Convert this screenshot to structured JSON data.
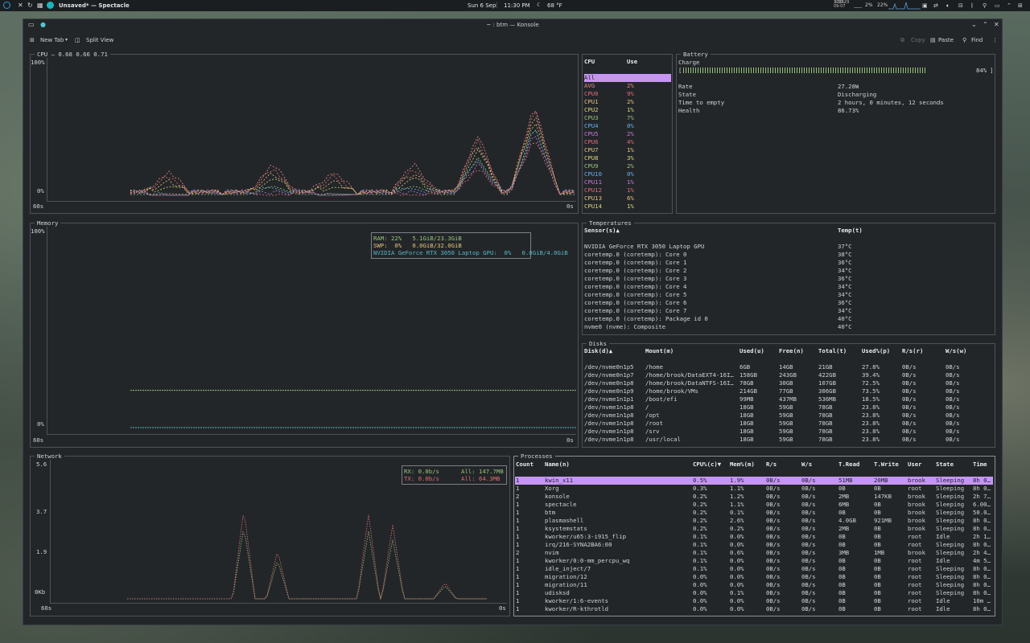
{
  "top_panel": {
    "app_title": "Unsaved* — Spectacle",
    "date": "Sun 6 Sep",
    "time": "11:30 PM",
    "weather": "68 °F",
    "small_clock_time": "3:30:29",
    "small_clock_date": "2026-09-07",
    "cpu_stat": "2%",
    "mem_stat": "22%"
  },
  "window": {
    "title": "~ : btm — Konsole",
    "toolbar": {
      "new_tab": "New Tab",
      "split_view": "Split View",
      "copy": "Copy",
      "paste": "Paste",
      "find": "Find"
    }
  },
  "cpu_graph": {
    "title": "CPU – 0.68 0.66 0.71",
    "y_top": "100%",
    "y_bottom": "0%",
    "x_left": "60s",
    "x_right": "0s"
  },
  "cpu_table": {
    "headers": [
      "CPU",
      "Use"
    ],
    "rows": [
      {
        "name": "All",
        "use": "",
        "color": "#1d1f22"
      },
      {
        "name": "AVG",
        "use": "2%",
        "color": "#e88a8a"
      },
      {
        "name": "CPU0",
        "use": "9%",
        "color": "#e06c75"
      },
      {
        "name": "CPU1",
        "use": "2%",
        "color": "#e5c07b"
      },
      {
        "name": "CPU2",
        "use": "1%",
        "color": "#d7d57a"
      },
      {
        "name": "CPU3",
        "use": "7%",
        "color": "#98c379"
      },
      {
        "name": "CPU4",
        "use": "0%",
        "color": "#61afef"
      },
      {
        "name": "CPU5",
        "use": "2%",
        "color": "#c678dd"
      },
      {
        "name": "CPU6",
        "use": "4%",
        "color": "#e06c75"
      },
      {
        "name": "CPU7",
        "use": "1%",
        "color": "#e5c07b"
      },
      {
        "name": "CPU8",
        "use": "3%",
        "color": "#d7d57a"
      },
      {
        "name": "CPU9",
        "use": "2%",
        "color": "#98c379"
      },
      {
        "name": "CPU10",
        "use": "0%",
        "color": "#61afef"
      },
      {
        "name": "CPU11",
        "use": "1%",
        "color": "#c678dd"
      },
      {
        "name": "CPU12",
        "use": "1%",
        "color": "#e06c75"
      },
      {
        "name": "CPU13",
        "use": "6%",
        "color": "#e5c07b"
      },
      {
        "name": "CPU14",
        "use": "1%",
        "color": "#d7d57a"
      }
    ]
  },
  "battery": {
    "title": "Battery",
    "charge_label": "Charge",
    "charge_pct_text": "84%",
    "charge_fraction": 0.84,
    "rows": [
      {
        "k": "Rate",
        "v": "27.28W"
      },
      {
        "k": "State",
        "v": "Discharging"
      },
      {
        "k": "Time to empty",
        "v": "2 hours, 0 minutes, 12 seconds"
      },
      {
        "k": "Health",
        "v": "86.73%"
      }
    ]
  },
  "memory": {
    "title": "Memory",
    "y_top": "100%",
    "y_bottom": "0%",
    "x_left": "60s",
    "x_right": "0s",
    "legend": [
      {
        "text": "RAM: 22%   5.1GiB/23.3GiB",
        "color": "#98c379"
      },
      {
        "text": "SWP:  0%   0.0GiB/32.0GiB",
        "color": "#e5c07b"
      },
      {
        "text": "NVIDIA GeForce RTX 3050 Laptop GPU:  0%   0.0GiB/4.0GiB",
        "color": "#56b6c2"
      }
    ],
    "ram_fraction": 0.22,
    "swap_fraction": 0.0
  },
  "temperatures": {
    "title": "Temperatures",
    "headers": [
      "Sensor(s)▲",
      "Temp(t)"
    ],
    "rows": [
      {
        "s": "NVIDIA GeForce RTX 3050 Laptop GPU",
        "t": "37°C"
      },
      {
        "s": "coretemp.0 (coretemp): Core 0",
        "t": "38°C"
      },
      {
        "s": "coretemp.0 (coretemp): Core 1",
        "t": "36°C"
      },
      {
        "s": "coretemp.0 (coretemp): Core 2",
        "t": "34°C"
      },
      {
        "s": "coretemp.0 (coretemp): Core 3",
        "t": "36°C"
      },
      {
        "s": "coretemp.0 (coretemp): Core 4",
        "t": "34°C"
      },
      {
        "s": "coretemp.0 (coretemp): Core 5",
        "t": "34°C"
      },
      {
        "s": "coretemp.0 (coretemp): Core 6",
        "t": "36°C"
      },
      {
        "s": "coretemp.0 (coretemp): Core 7",
        "t": "34°C"
      },
      {
        "s": "coretemp.0 (coretemp): Package id 0",
        "t": "40°C"
      },
      {
        "s": "nvme0 (nvme): Composite",
        "t": "40°C"
      }
    ]
  },
  "disks": {
    "title": "Disks",
    "headers": [
      "Disk(d)▲",
      "Mount(m)",
      "Used(u)",
      "Free(n)",
      "Total(t)",
      "Used%(p)",
      "R/s(r)",
      "W/s(w)"
    ],
    "rows": [
      [
        "/dev/nvme0n1p5",
        "/home",
        "6GB",
        "14GB",
        "21GB",
        "27.8%",
        "0B/s",
        "0B/s"
      ],
      [
        "/dev/nvme0n1p7",
        "/home/brook/DataEXT4-16I…",
        "158GB",
        "243GB",
        "422GB",
        "39.4%",
        "0B/s",
        "0B/s"
      ],
      [
        "/dev/nvme0n1p8",
        "/home/brook/DataNTFS-16I…",
        "78GB",
        "30GB",
        "107GB",
        "72.5%",
        "0B/s",
        "0B/s"
      ],
      [
        "/dev/nvme0n1p9",
        "/home/brook/VMs",
        "214GB",
        "77GB",
        "306GB",
        "73.5%",
        "0B/s",
        "0B/s"
      ],
      [
        "/dev/nvme1n1p1",
        "/boot/efi",
        "99MB",
        "437MB",
        "536MB",
        "18.5%",
        "0B/s",
        "0B/s"
      ],
      [
        "/dev/nvme1n1p8",
        "/",
        "18GB",
        "59GB",
        "78GB",
        "23.8%",
        "0B/s",
        "0B/s"
      ],
      [
        "/dev/nvme1n1p8",
        "/opt",
        "18GB",
        "59GB",
        "78GB",
        "23.8%",
        "0B/s",
        "0B/s"
      ],
      [
        "/dev/nvme1n1p8",
        "/root",
        "18GB",
        "59GB",
        "78GB",
        "23.8%",
        "0B/s",
        "0B/s"
      ],
      [
        "/dev/nvme1n1p8",
        "/srv",
        "18GB",
        "59GB",
        "78GB",
        "23.8%",
        "0B/s",
        "0B/s"
      ],
      [
        "/dev/nvme1n1p8",
        "/usr/local",
        "18GB",
        "59GB",
        "78GB",
        "23.8%",
        "0B/s",
        "0B/s"
      ]
    ]
  },
  "network": {
    "title": "Network",
    "y_ticks": [
      "5.6",
      "3.7",
      "1.9",
      "0Kb"
    ],
    "x_left": "60s",
    "x_right": "0s",
    "legend": [
      {
        "a": "RX: 0.0b/s",
        "b": "All: 147.7MB",
        "color": "#98c379"
      },
      {
        "a": "TX: 0.0b/s",
        "b": "All: 64.3MB",
        "color": "#e06c75"
      }
    ]
  },
  "processes": {
    "title": "Processes",
    "headers": [
      "Count",
      "Name(n)",
      "CPU%(c)▼",
      "Mem%(m)",
      "R/s",
      "W/s",
      "T.Read",
      "T.Write",
      "User",
      "State",
      "Time"
    ],
    "rows": [
      [
        "1",
        "kwin_x11",
        "0.5%",
        "1.9%",
        "0B/s",
        "0B/s",
        "51MB",
        "20MB",
        "brook",
        "Sleeping",
        "8h 0…"
      ],
      [
        "1",
        "Xorg",
        "0.3%",
        "1.1%",
        "0B/s",
        "0B/s",
        "0B",
        "0B",
        "root",
        "Sleeping",
        "8h 0…"
      ],
      [
        "2",
        "konsole",
        "0.2%",
        "1.2%",
        "0B/s",
        "0B/s",
        "2MB",
        "147KB",
        "brook",
        "Sleeping",
        "2h 7…"
      ],
      [
        "1",
        "spectacle",
        "0.2%",
        "1.1%",
        "0B/s",
        "0B/s",
        "6MB",
        "0B",
        "brook",
        "Sleeping",
        "6.00…"
      ],
      [
        "1",
        "btm",
        "0.2%",
        "0.1%",
        "0B/s",
        "0B/s",
        "0B",
        "0B",
        "brook",
        "Sleeping",
        "50.0…"
      ],
      [
        "1",
        "plasmashell",
        "0.2%",
        "2.6%",
        "0B/s",
        "0B/s",
        "4.0GB",
        "921MB",
        "brook",
        "Sleeping",
        "8h 0…"
      ],
      [
        "1",
        "ksystemstats",
        "0.2%",
        "0.2%",
        "0B/s",
        "0B/s",
        "2MB",
        "0B",
        "brook",
        "Sleeping",
        "8h 0…"
      ],
      [
        "1",
        "kworker/u65:3-i915_flip",
        "0.1%",
        "0.0%",
        "0B/s",
        "0B/s",
        "0B",
        "0B",
        "root",
        "Idle",
        "2h 1…"
      ],
      [
        "1",
        "irq/216-SYNA2BA6:00",
        "0.1%",
        "0.0%",
        "0B/s",
        "0B/s",
        "0B",
        "0B",
        "root",
        "Sleeping",
        "8h 0…"
      ],
      [
        "2",
        "nvim",
        "0.1%",
        "0.6%",
        "0B/s",
        "0B/s",
        "3MB",
        "1MB",
        "brook",
        "Sleeping",
        "2h 4…"
      ],
      [
        "1",
        "kworker/0:0-mm_percpu_wq",
        "0.1%",
        "0.0%",
        "0B/s",
        "0B/s",
        "0B",
        "0B",
        "root",
        "Idle",
        "4m 5…"
      ],
      [
        "1",
        "idle_inject/7",
        "0.1%",
        "0.0%",
        "0B/s",
        "0B/s",
        "0B",
        "0B",
        "root",
        "Sleeping",
        "8h 0…"
      ],
      [
        "1",
        "migration/12",
        "0.0%",
        "0.0%",
        "0B/s",
        "0B/s",
        "0B",
        "0B",
        "root",
        "Sleeping",
        "8h 0…"
      ],
      [
        "1",
        "migration/11",
        "0.0%",
        "0.0%",
        "0B/s",
        "0B/s",
        "0B",
        "0B",
        "root",
        "Sleeping",
        "8h 0…"
      ],
      [
        "1",
        "udisksd",
        "0.0%",
        "0.1%",
        "0B/s",
        "0B/s",
        "0B",
        "0B",
        "root",
        "Sleeping",
        "8h 0…"
      ],
      [
        "1",
        "kworker/1:6-events",
        "0.0%",
        "0.0%",
        "0B/s",
        "0B/s",
        "0B",
        "0B",
        "root",
        "Idle",
        "10m …"
      ],
      [
        "1",
        "kworker/R-kthrotld",
        "0.0%",
        "0.0%",
        "0B/s",
        "0B/s",
        "0B",
        "0B",
        "root",
        "Idle",
        "8h 0…"
      ]
    ]
  },
  "colors": {
    "selection": "#c695f2",
    "panel_border": "#4d5257",
    "background": "#232629",
    "ram": "#98c379",
    "swap": "#e5c07b",
    "gpu": "#56b6c2",
    "rx": "#98c379",
    "tx": "#e06c75"
  }
}
